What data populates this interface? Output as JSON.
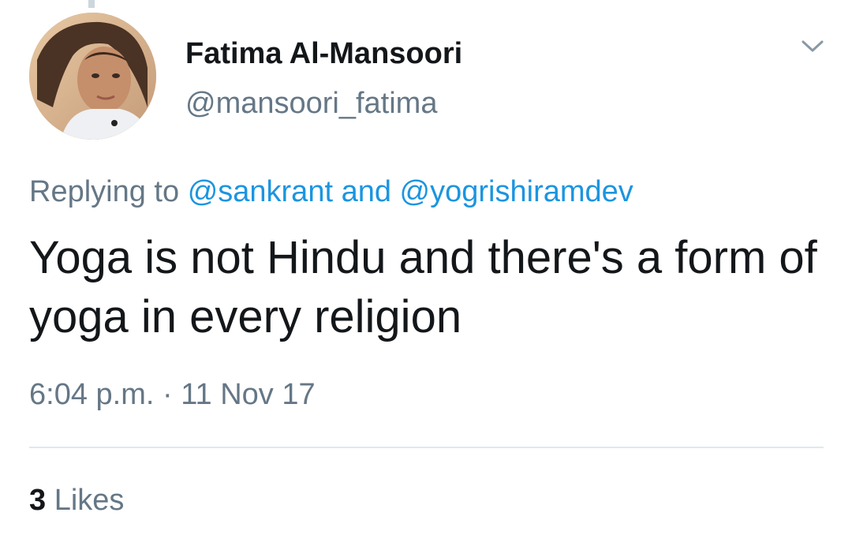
{
  "author": {
    "display_name": "Fatima Al-Mansoori",
    "handle": "@mansoori_fatima",
    "avatar_icon": "profile-photo"
  },
  "reply": {
    "prefix": "Replying to",
    "mention_1": "@sankrant",
    "conjunction": "and",
    "mention_2": "@yogrishiramdev"
  },
  "tweet": {
    "text": "Yoga is not Hindu and there's a form of yoga in every religion"
  },
  "meta": {
    "time": "6:04 p.m.",
    "separator": "·",
    "date": "11 Nov 17"
  },
  "stats": {
    "likes_count": "3",
    "likes_label": "Likes"
  },
  "icons": {
    "menu_caret": "chevron-down-icon"
  },
  "colors": {
    "text_primary": "#14171a",
    "text_secondary": "#657786",
    "link": "#1b95e0",
    "divider": "#e1e8ed"
  }
}
